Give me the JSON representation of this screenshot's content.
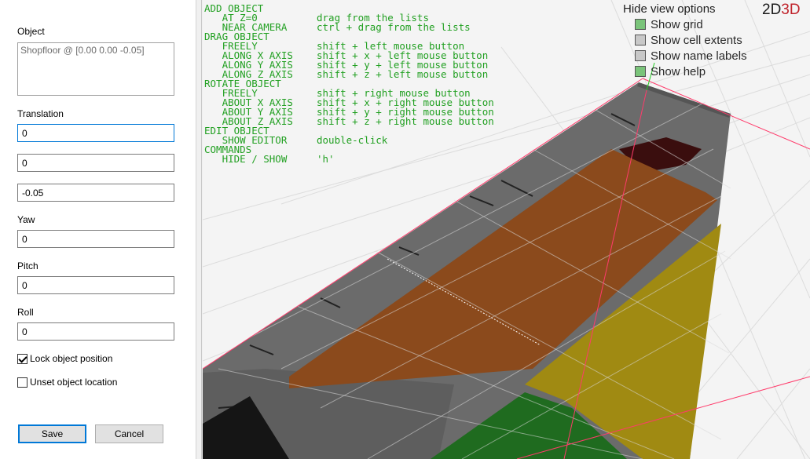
{
  "panel": {
    "object_label": "Object",
    "object_value": "Shopfloor @ [0.00 0.00 -0.05]",
    "translation_label": "Translation",
    "translation_x": "0",
    "translation_y": "0",
    "translation_z": "-0.05",
    "yaw_label": "Yaw",
    "yaw_value": "0",
    "pitch_label": "Pitch",
    "pitch_value": "0",
    "roll_label": "Roll",
    "roll_value": "0",
    "lock_label": "Lock object position",
    "lock_checked": true,
    "unset_label": "Unset object location",
    "unset_checked": false,
    "save_label": "Save",
    "cancel_label": "Cancel"
  },
  "viewport": {
    "help_lines": [
      "ADD OBJECT",
      "   AT Z=0          drag from the lists",
      "   NEAR CAMERA     ctrl + drag from the lists",
      "DRAG OBJECT",
      "   FREELY          shift + left mouse button",
      "   ALONG X AXIS    shift + x + left mouse button",
      "   ALONG Y AXIS    shift + y + left mouse button",
      "   ALONG Z AXIS    shift + z + left mouse button",
      "ROTATE OBJECT",
      "   FREELY          shift + right mouse button",
      "   ABOUT X AXIS    shift + x + right mouse button",
      "   ABOUT Y AXIS    shift + y + right mouse button",
      "   ABOUT Z AXIS    shift + z + right mouse button",
      "EDIT OBJECT",
      "   SHOW EDITOR     double-click",
      "COMMANDS",
      "   HIDE / SHOW     'h'"
    ],
    "view_options_title": "Hide view options",
    "options": [
      {
        "label": "Show grid",
        "checked": true
      },
      {
        "label": "Show cell extents",
        "checked": false
      },
      {
        "label": "Show name labels",
        "checked": false
      },
      {
        "label": "Show help",
        "checked": true
      }
    ],
    "mode_2d": "2D",
    "mode_3d": "3D",
    "colors": {
      "help_text": "#22a022",
      "floor": "#6b6b6b",
      "orange_zone": "#8b4a1c",
      "yellow_zone": "#a08a12",
      "green_zone": "#1f6b1f",
      "dark_red_zone": "#3a0e0e",
      "axis_red": "#ff3b6b",
      "mode_3d": "#c0232b"
    }
  }
}
